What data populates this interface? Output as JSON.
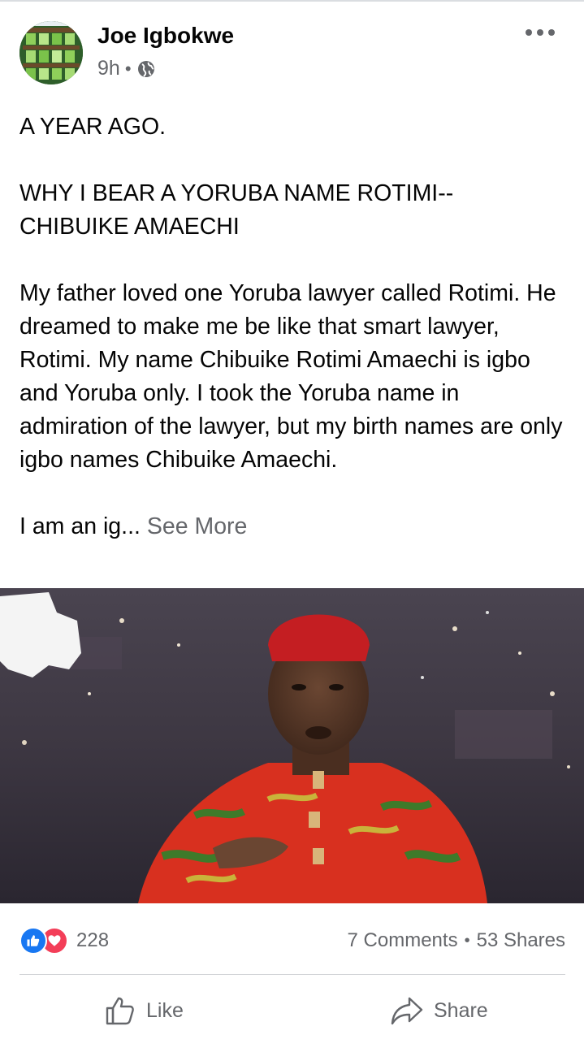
{
  "post": {
    "author": "Joe Igbokwe",
    "time": "9h",
    "separator": "•",
    "privacy_icon": "globe-icon",
    "text": {
      "line1": "A YEAR AGO.",
      "headline": "WHY I BEAR A YORUBA NAME ROTIMI-- CHIBUIKE AMAECHI",
      "body": "My father loved one Yoruba lawyer called Rotimi. He dreamed to make me be like that smart  lawyer, Rotimi. My name Chibuike Rotimi Amaechi is igbo and Yoruba only. I took the Yoruba name in admiration of the lawyer, but my birth names are only igbo names Chibuike Amaechi.",
      "truncated": "I am an ig...",
      "see_more": "See More"
    }
  },
  "stats": {
    "reaction_icons": [
      "like-reaction-icon",
      "love-reaction-icon"
    ],
    "reaction_count": "228",
    "comments": "7 Comments",
    "dot": "•",
    "shares": "53 Shares"
  },
  "actions": {
    "like_label": "Like",
    "share_label": "Share"
  },
  "colors": {
    "like_blue": "#1877f2",
    "love_red": "#f33e58",
    "secondary_text": "#65676b"
  }
}
